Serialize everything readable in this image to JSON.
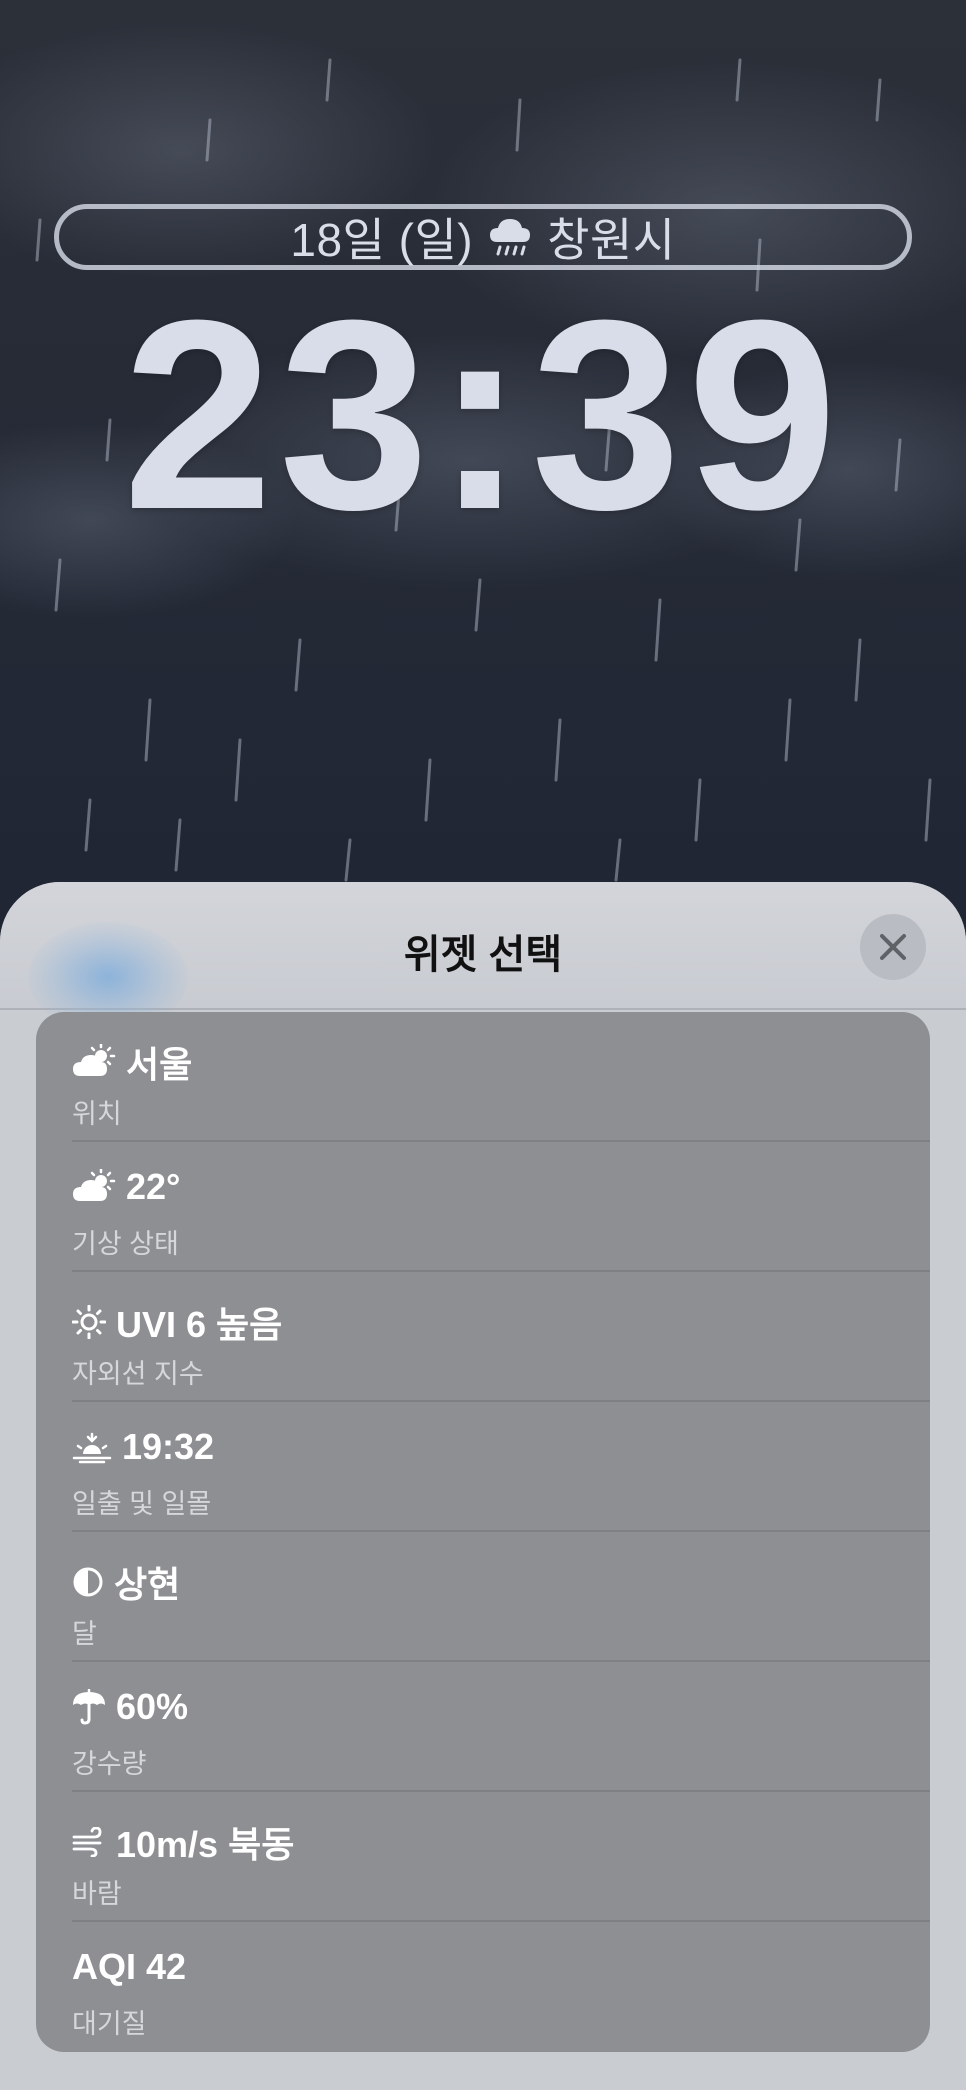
{
  "lockscreen": {
    "date_label": "18일 (일)",
    "location_label": "창원시",
    "time": "23:39"
  },
  "sheet": {
    "title": "위젯 선택",
    "close_icon": "close-icon",
    "items": [
      {
        "icon": "partly-cloudy-icon",
        "value": "서울",
        "label": "위치"
      },
      {
        "icon": "partly-cloudy-icon",
        "value": "22°",
        "label": "기상 상태"
      },
      {
        "icon": "sun-icon",
        "value": "UVI 6 높음",
        "label": "자외선 지수"
      },
      {
        "icon": "sunset-icon",
        "value": "19:32",
        "label": "일출 및 일몰"
      },
      {
        "icon": "half-moon-icon",
        "value": "상현",
        "label": "달"
      },
      {
        "icon": "umbrella-icon",
        "value": "60%",
        "label": "강수량"
      },
      {
        "icon": "wind-icon",
        "value": "10m/s 북동",
        "label": "바람"
      },
      {
        "icon": "",
        "value": "AQI 42",
        "label": "대기질"
      }
    ]
  }
}
